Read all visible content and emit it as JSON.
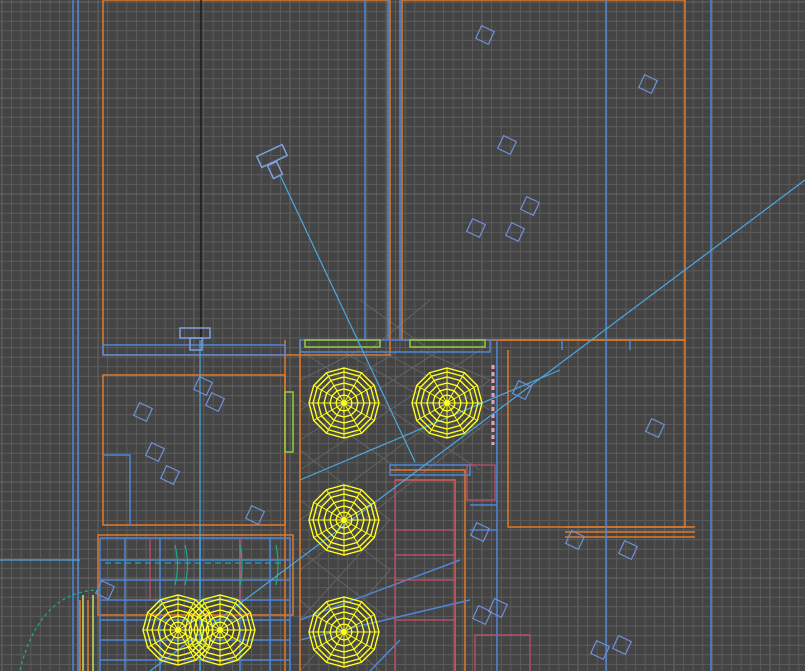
{
  "viewport": {
    "view": "top",
    "background_color": "#444444",
    "grid_color": "#5c5c5c",
    "grid_major_color": "#666666"
  },
  "colors": {
    "wall_orange": "#e07a2a",
    "wall_blue": "#4f86d8",
    "light_blue": "#4aa8e0",
    "lamp_yellow": "#ffff1e",
    "pink": "#c8506a",
    "green": "#8fcf3a",
    "teal": "#1ab08a",
    "hatch": "#6a6a6a",
    "black": "#111111"
  },
  "objects": {
    "lamp_count": 6,
    "camera_count": 2,
    "marker_count": 22
  }
}
